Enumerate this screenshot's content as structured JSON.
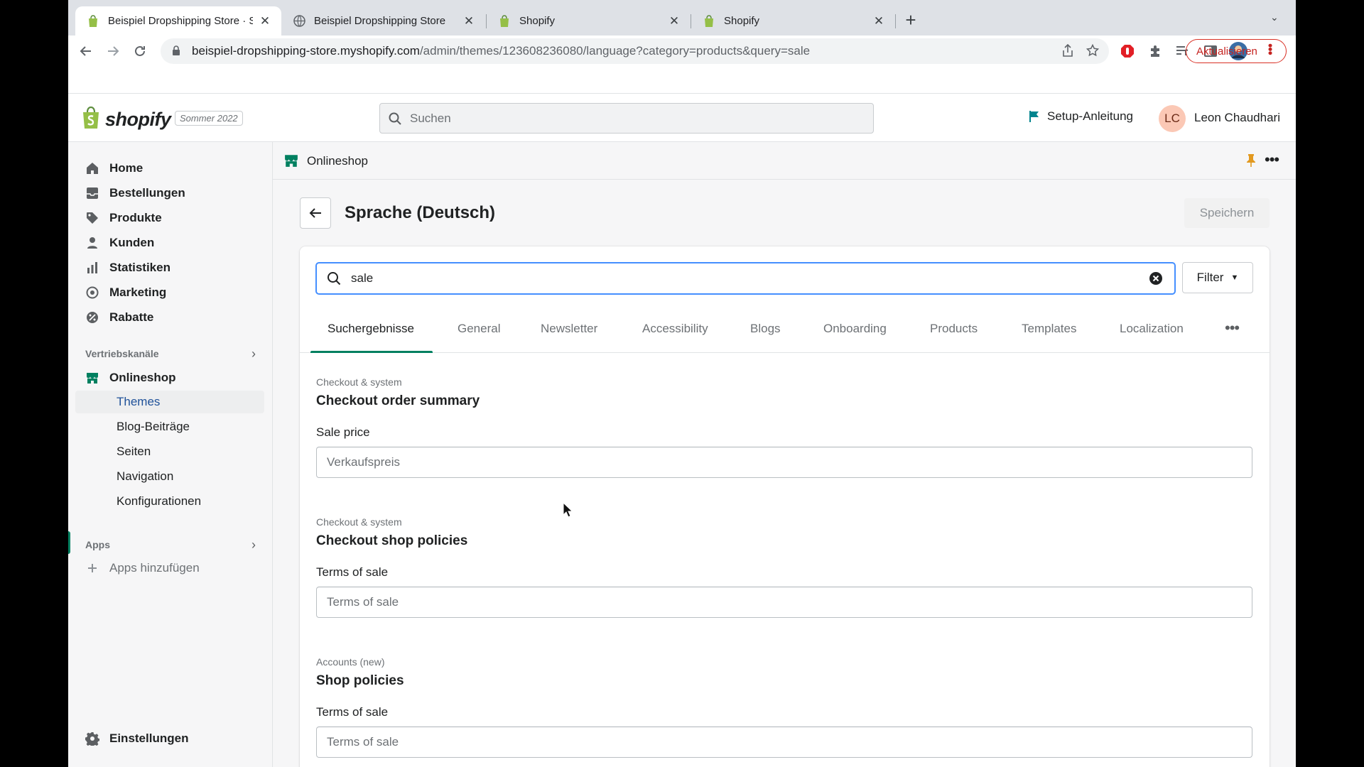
{
  "browser": {
    "tabs": [
      {
        "title": "Beispiel Dropshipping Store · S",
        "close": "✕"
      },
      {
        "title": "Beispiel Dropshipping Store",
        "close": "✕"
      },
      {
        "title": "Shopify",
        "close": "✕"
      },
      {
        "title": "Shopify",
        "close": "✕"
      }
    ],
    "new_tab": "+",
    "tab_menu": "⌄",
    "url_host": "beispiel-dropshipping-store.myshopify.com",
    "url_path": "/admin/themes/123608236080/language?category=products&query=sale",
    "update_label": "Aktualisieren"
  },
  "topbar": {
    "logo": "shopify",
    "edition": "Sommer 2022",
    "search_placeholder": "Suchen",
    "setup_label": "Setup-Anleitung",
    "avatar_initials": "LC",
    "user_name": "Leon Chaudhari"
  },
  "sidebar": {
    "items": [
      {
        "label": "Home"
      },
      {
        "label": "Bestellungen"
      },
      {
        "label": "Produkte"
      },
      {
        "label": "Kunden"
      },
      {
        "label": "Statistiken"
      },
      {
        "label": "Marketing"
      },
      {
        "label": "Rabatte"
      }
    ],
    "sales_channels_heading": "Vertriebskanäle",
    "onlineshop": "Onlineshop",
    "sub_items": [
      {
        "label": "Themes"
      },
      {
        "label": "Blog-Beiträge"
      },
      {
        "label": "Seiten"
      },
      {
        "label": "Navigation"
      },
      {
        "label": "Konfigurationen"
      }
    ],
    "apps_heading": "Apps",
    "add_apps": "Apps hinzufügen",
    "settings": "Einstellungen"
  },
  "main": {
    "app_name": "Onlineshop",
    "page_title": "Sprache (Deutsch)",
    "save_label": "Speichern",
    "search_value": "sale",
    "filter_label": "Filter",
    "tabs": [
      {
        "label": "Suchergebnisse"
      },
      {
        "label": "General"
      },
      {
        "label": "Newsletter"
      },
      {
        "label": "Accessibility"
      },
      {
        "label": "Blogs"
      },
      {
        "label": "Onboarding"
      },
      {
        "label": "Products"
      },
      {
        "label": "Templates"
      },
      {
        "label": "Localization"
      }
    ],
    "groups": [
      {
        "category": "Checkout & system",
        "title": "Checkout order summary",
        "label": "Sale price",
        "value": "Verkaufspreis"
      },
      {
        "category": "Checkout & system",
        "title": "Checkout shop policies",
        "label": "Terms of sale",
        "value": "Terms of sale"
      },
      {
        "category": "Accounts (new)",
        "title": "Shop policies",
        "label": "Terms of sale",
        "value": "Terms of sale"
      }
    ]
  },
  "colors": {
    "accent": "#008060",
    "focus": "#458fff",
    "active_nav_text": "#1f5199"
  }
}
